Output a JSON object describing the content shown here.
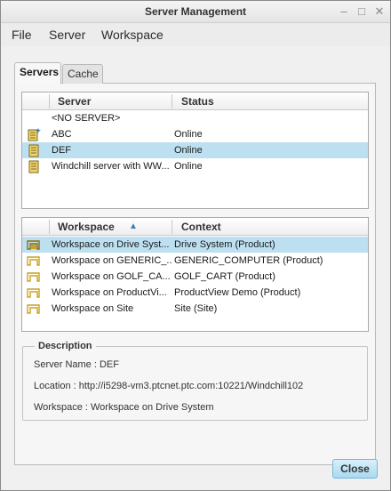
{
  "window": {
    "title": "Server Management"
  },
  "menubar": {
    "items": [
      "File",
      "Server",
      "Workspace"
    ]
  },
  "tabs": [
    {
      "label": "Servers",
      "active": true
    },
    {
      "label": "Cache",
      "active": false
    }
  ],
  "servers_table": {
    "columns": [
      "Server",
      "Status"
    ],
    "rows": [
      {
        "server": "<NO SERVER>",
        "status": "",
        "icon": "none",
        "selected": false
      },
      {
        "server": "ABC",
        "status": "Online",
        "icon": "server-active-icon",
        "selected": false
      },
      {
        "server": "DEF",
        "status": "Online",
        "icon": "server-icon",
        "selected": true
      },
      {
        "server": "Windchill server with WW...",
        "status": "Online",
        "icon": "server-icon",
        "selected": false
      }
    ]
  },
  "workspace_table": {
    "columns": [
      "Workspace",
      "Context"
    ],
    "sort_indicator": "▲",
    "rows": [
      {
        "workspace": "Workspace on Drive Syst...",
        "context": "Drive System (Product)",
        "selected": true
      },
      {
        "workspace": "Workspace on GENERIC_...",
        "context": "GENERIC_COMPUTER (Product)",
        "selected": false
      },
      {
        "workspace": "Workspace on GOLF_CA...",
        "context": "GOLF_CART (Product)",
        "selected": false
      },
      {
        "workspace": "Workspace on ProductVi...",
        "context": "ProductView Demo (Product)",
        "selected": false
      },
      {
        "workspace": "Workspace on Site",
        "context": "Site (Site)",
        "selected": false
      }
    ]
  },
  "description": {
    "legend": "Description",
    "server_name": "Server Name : DEF",
    "location": "Location : http://i5298-vm3.ptcnet.ptc.com:10221/Windchill102",
    "workspace": "Workspace : Workspace on Drive System"
  },
  "buttons": {
    "close": "Close"
  },
  "colors": {
    "selected_row": "#bde0f1",
    "sort_arrow": "#3a7fc1",
    "workspace_icon": "#c9a227"
  }
}
